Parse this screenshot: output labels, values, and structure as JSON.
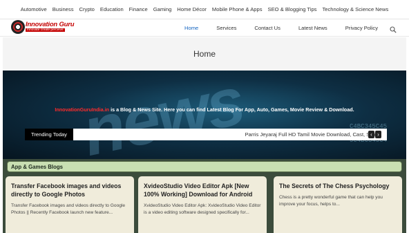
{
  "top_categories": [
    "Automotive",
    "Business",
    "Crypto",
    "Education",
    "Finance",
    "Gaming",
    "Home Décor",
    "Mobile Phone & Apps",
    "SEO & Blogging Tips",
    "Technology & Science News"
  ],
  "logo": {
    "name": "Innovation Guru",
    "tagline": "Innovate create perceive"
  },
  "nav": {
    "items": [
      "Home",
      "Services",
      "Contact Us",
      "Latest News",
      "Privacy Policy"
    ],
    "active": "Home",
    "search_icon": "search-icon"
  },
  "page": {
    "title": "Home"
  },
  "hero": {
    "site_name": "InnovationGuruIndia.in",
    "intro_text": " is a Blog & News Site. Here you can find Latest Blog For App, Auto, Games, Movie Review & Download.",
    "trending_label": "Trending Today",
    "trending_item": "Parris Jeyaraj Full HD Tamil Movie Download, Cast, Story",
    "prev_arrow": "‹",
    "next_arrow": "›"
  },
  "section": {
    "title": "App & Games Blogs"
  },
  "cards": [
    {
      "title": "Transfer Facebook images and videos directly to Google Photos",
      "excerpt": "Transfer Facebook images and videos directly to Google Photos || Recently Facebook launch new feature..."
    },
    {
      "title": "XvideoStudio Video Editor Apk [New 100% Working] Download for Android",
      "excerpt": "XvideoStudio Video Editor Apk: XvideoStudio Video Editor is a video editing software designed specifically for..."
    },
    {
      "title": "The Secrets of The Chess Psychology",
      "excerpt": "Chess is a pretty wonderful game that can help you improve your focus, helps to..."
    }
  ],
  "colors": {
    "accent": "#1565c0",
    "brand_red": "#c40000",
    "section_green": "#c9dfb2",
    "card_bg": "#f0ecdb"
  }
}
